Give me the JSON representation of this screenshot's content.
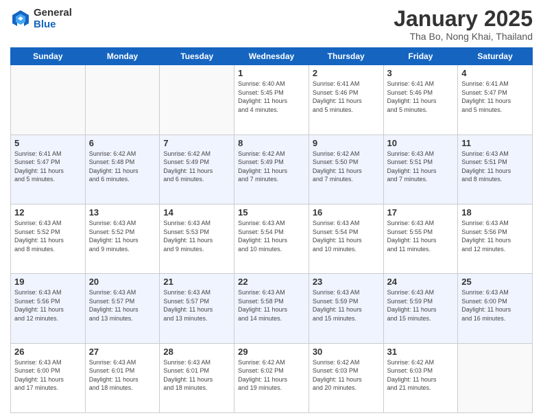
{
  "header": {
    "logo_general": "General",
    "logo_blue": "Blue",
    "month_title": "January 2025",
    "subtitle": "Tha Bo, Nong Khai, Thailand"
  },
  "weekdays": [
    "Sunday",
    "Monday",
    "Tuesday",
    "Wednesday",
    "Thursday",
    "Friday",
    "Saturday"
  ],
  "weeks": [
    [
      {
        "day": "",
        "info": ""
      },
      {
        "day": "",
        "info": ""
      },
      {
        "day": "",
        "info": ""
      },
      {
        "day": "1",
        "info": "Sunrise: 6:40 AM\nSunset: 5:45 PM\nDaylight: 11 hours\nand 4 minutes."
      },
      {
        "day": "2",
        "info": "Sunrise: 6:41 AM\nSunset: 5:46 PM\nDaylight: 11 hours\nand 5 minutes."
      },
      {
        "day": "3",
        "info": "Sunrise: 6:41 AM\nSunset: 5:46 PM\nDaylight: 11 hours\nand 5 minutes."
      },
      {
        "day": "4",
        "info": "Sunrise: 6:41 AM\nSunset: 5:47 PM\nDaylight: 11 hours\nand 5 minutes."
      }
    ],
    [
      {
        "day": "5",
        "info": "Sunrise: 6:41 AM\nSunset: 5:47 PM\nDaylight: 11 hours\nand 5 minutes."
      },
      {
        "day": "6",
        "info": "Sunrise: 6:42 AM\nSunset: 5:48 PM\nDaylight: 11 hours\nand 6 minutes."
      },
      {
        "day": "7",
        "info": "Sunrise: 6:42 AM\nSunset: 5:49 PM\nDaylight: 11 hours\nand 6 minutes."
      },
      {
        "day": "8",
        "info": "Sunrise: 6:42 AM\nSunset: 5:49 PM\nDaylight: 11 hours\nand 7 minutes."
      },
      {
        "day": "9",
        "info": "Sunrise: 6:42 AM\nSunset: 5:50 PM\nDaylight: 11 hours\nand 7 minutes."
      },
      {
        "day": "10",
        "info": "Sunrise: 6:43 AM\nSunset: 5:51 PM\nDaylight: 11 hours\nand 7 minutes."
      },
      {
        "day": "11",
        "info": "Sunrise: 6:43 AM\nSunset: 5:51 PM\nDaylight: 11 hours\nand 8 minutes."
      }
    ],
    [
      {
        "day": "12",
        "info": "Sunrise: 6:43 AM\nSunset: 5:52 PM\nDaylight: 11 hours\nand 8 minutes."
      },
      {
        "day": "13",
        "info": "Sunrise: 6:43 AM\nSunset: 5:52 PM\nDaylight: 11 hours\nand 9 minutes."
      },
      {
        "day": "14",
        "info": "Sunrise: 6:43 AM\nSunset: 5:53 PM\nDaylight: 11 hours\nand 9 minutes."
      },
      {
        "day": "15",
        "info": "Sunrise: 6:43 AM\nSunset: 5:54 PM\nDaylight: 11 hours\nand 10 minutes."
      },
      {
        "day": "16",
        "info": "Sunrise: 6:43 AM\nSunset: 5:54 PM\nDaylight: 11 hours\nand 10 minutes."
      },
      {
        "day": "17",
        "info": "Sunrise: 6:43 AM\nSunset: 5:55 PM\nDaylight: 11 hours\nand 11 minutes."
      },
      {
        "day": "18",
        "info": "Sunrise: 6:43 AM\nSunset: 5:56 PM\nDaylight: 11 hours\nand 12 minutes."
      }
    ],
    [
      {
        "day": "19",
        "info": "Sunrise: 6:43 AM\nSunset: 5:56 PM\nDaylight: 11 hours\nand 12 minutes."
      },
      {
        "day": "20",
        "info": "Sunrise: 6:43 AM\nSunset: 5:57 PM\nDaylight: 11 hours\nand 13 minutes."
      },
      {
        "day": "21",
        "info": "Sunrise: 6:43 AM\nSunset: 5:57 PM\nDaylight: 11 hours\nand 13 minutes."
      },
      {
        "day": "22",
        "info": "Sunrise: 6:43 AM\nSunset: 5:58 PM\nDaylight: 11 hours\nand 14 minutes."
      },
      {
        "day": "23",
        "info": "Sunrise: 6:43 AM\nSunset: 5:59 PM\nDaylight: 11 hours\nand 15 minutes."
      },
      {
        "day": "24",
        "info": "Sunrise: 6:43 AM\nSunset: 5:59 PM\nDaylight: 11 hours\nand 15 minutes."
      },
      {
        "day": "25",
        "info": "Sunrise: 6:43 AM\nSunset: 6:00 PM\nDaylight: 11 hours\nand 16 minutes."
      }
    ],
    [
      {
        "day": "26",
        "info": "Sunrise: 6:43 AM\nSunset: 6:00 PM\nDaylight: 11 hours\nand 17 minutes."
      },
      {
        "day": "27",
        "info": "Sunrise: 6:43 AM\nSunset: 6:01 PM\nDaylight: 11 hours\nand 18 minutes."
      },
      {
        "day": "28",
        "info": "Sunrise: 6:43 AM\nSunset: 6:01 PM\nDaylight: 11 hours\nand 18 minutes."
      },
      {
        "day": "29",
        "info": "Sunrise: 6:42 AM\nSunset: 6:02 PM\nDaylight: 11 hours\nand 19 minutes."
      },
      {
        "day": "30",
        "info": "Sunrise: 6:42 AM\nSunset: 6:03 PM\nDaylight: 11 hours\nand 20 minutes."
      },
      {
        "day": "31",
        "info": "Sunrise: 6:42 AM\nSunset: 6:03 PM\nDaylight: 11 hours\nand 21 minutes."
      },
      {
        "day": "",
        "info": ""
      }
    ]
  ]
}
